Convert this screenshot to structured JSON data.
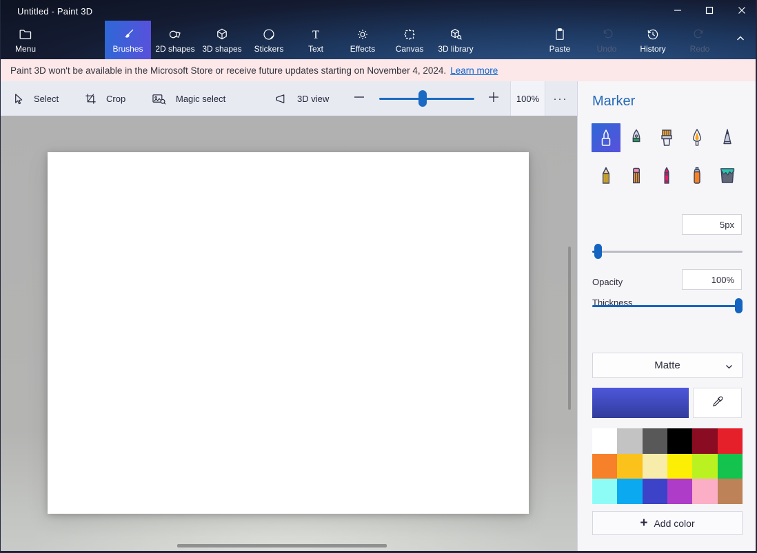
{
  "window": {
    "title": "Untitled - Paint 3D"
  },
  "toolbar": {
    "items": [
      {
        "label": "Menu",
        "state": "normal"
      },
      {
        "label": "Brushes",
        "state": "selected"
      },
      {
        "label": "2D shapes",
        "state": "normal"
      },
      {
        "label": "3D shapes",
        "state": "normal"
      },
      {
        "label": "Stickers",
        "state": "normal"
      },
      {
        "label": "Text",
        "state": "normal"
      },
      {
        "label": "Effects",
        "state": "normal"
      },
      {
        "label": "Canvas",
        "state": "normal"
      },
      {
        "label": "3D library",
        "state": "normal"
      },
      {
        "label": "Paste",
        "state": "normal"
      },
      {
        "label": "Undo",
        "state": "disabled"
      },
      {
        "label": "History",
        "state": "normal"
      },
      {
        "label": "Redo",
        "state": "disabled"
      }
    ]
  },
  "banner": {
    "message": "Paint 3D won't be available in the Microsoft Store or receive future updates starting on November 4, 2024.",
    "link_label": "Learn more"
  },
  "editbar": {
    "select_label": "Select",
    "crop_label": "Crop",
    "magic_select_label": "Magic select",
    "view3d_label": "3D view",
    "zoom_value": "100%",
    "more_icon": "···"
  },
  "panel": {
    "title": "Marker",
    "brushes": [
      {
        "name": "marker",
        "selected": true
      },
      {
        "name": "calligraphy-pen",
        "selected": false
      },
      {
        "name": "oil-brush",
        "selected": false
      },
      {
        "name": "watercolor",
        "selected": false
      },
      {
        "name": "pixel-pen",
        "selected": false
      },
      {
        "name": "pencil",
        "selected": false
      },
      {
        "name": "eraser",
        "selected": false
      },
      {
        "name": "crayon",
        "selected": false
      },
      {
        "name": "spray-can",
        "selected": false
      },
      {
        "name": "fill",
        "selected": false
      }
    ],
    "thickness": {
      "label": "Thickness",
      "value": "5px"
    },
    "opacity": {
      "label": "Opacity",
      "value": "100%"
    },
    "finish_value": "Matte",
    "current_color_gradient": {
      "top": "#4d57da",
      "bottom": "#323c9c"
    },
    "palette": [
      "#ffffff",
      "#c3c3c3",
      "#585858",
      "#000000",
      "#8a0c22",
      "#e6202a",
      "#f7802b",
      "#fcc21c",
      "#f8ecaa",
      "#fcee04",
      "#b9f220",
      "#14c24e",
      "#8efcf6",
      "#0baaf0",
      "#3c43c8",
      "#ae3cc9",
      "#fcaec6",
      "#bd8258"
    ],
    "add_color_label": "Add color"
  },
  "colors": {
    "accent_blue": "#1a6ac4",
    "selected_gradient_left": "#2e68d6",
    "selected_gradient_right": "#5950dc",
    "banner_background": "#fce8e9",
    "header_blue": "#1e3a63"
  }
}
